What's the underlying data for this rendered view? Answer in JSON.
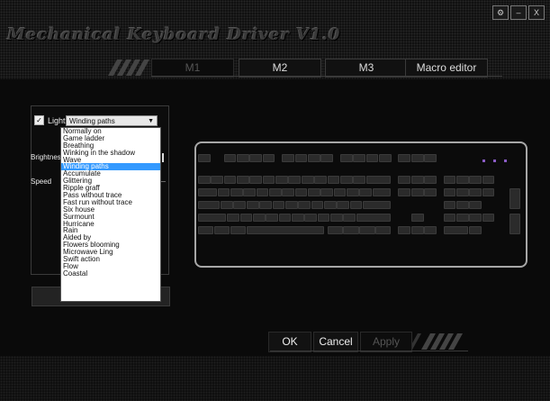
{
  "app": {
    "title": "Mechanical Keyboard Driver V1.0",
    "window_controls": [
      "⚙",
      "–",
      "X"
    ]
  },
  "tabs": [
    {
      "label": "M1",
      "active": false
    },
    {
      "label": "M2",
      "active": true
    },
    {
      "label": "M3",
      "active": true
    },
    {
      "label": "Macro editor",
      "active": true
    }
  ],
  "panel": {
    "light_label": "Light",
    "light_checked": true,
    "effect_selected": "Winding paths",
    "brightness_label": "Brightness",
    "speed_label": "Speed"
  },
  "effects": [
    "Normally on",
    "Game ladder",
    "Breathing",
    "Winking in the shadow",
    "Wave",
    "Winding paths",
    "Accumulate",
    "Glittering",
    "Ripple graff",
    "Pass without trace",
    "Fast run without trace",
    "Six house",
    "Surmount",
    "Hurricane",
    "Rain",
    "Aided by",
    "Flowers blooming",
    "Microwave Ling",
    "Swift action",
    "Flow",
    "Coastal"
  ],
  "footer": {
    "ok": "OK",
    "cancel": "Cancel",
    "apply": "Apply"
  },
  "colors": {
    "key_legend": "#b070d0",
    "selection": "#3399ff"
  }
}
